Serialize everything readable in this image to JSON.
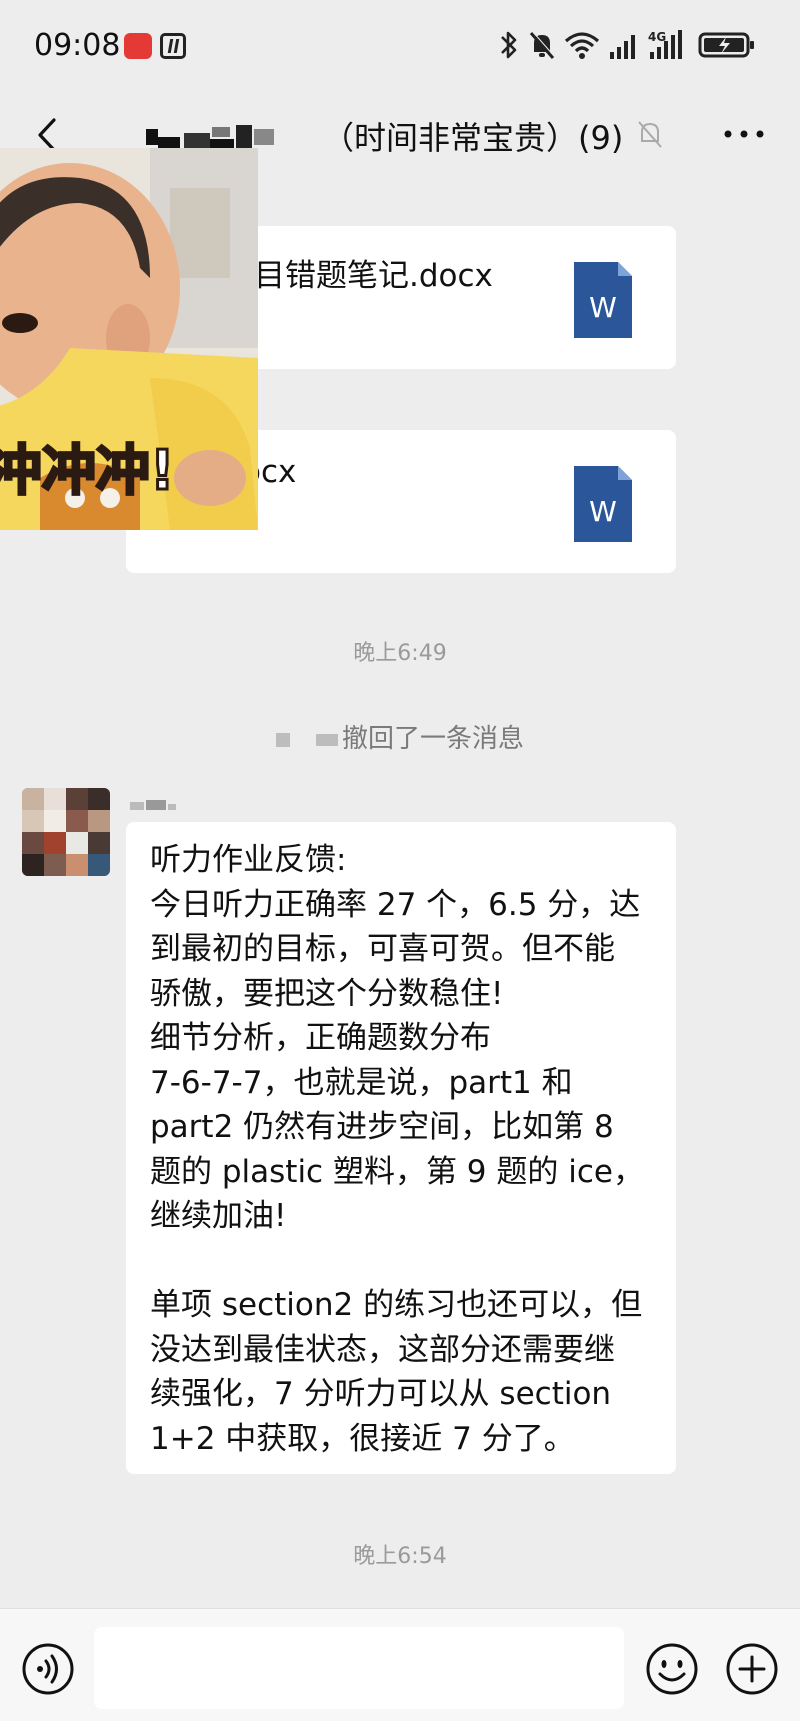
{
  "status_bar": {
    "time": "09:08",
    "icons": [
      "bluetooth-icon",
      "mute-bell-icon",
      "wifi-icon",
      "signal-icon",
      "4g-signal-icon",
      "battery-charging-icon"
    ],
    "network_label": "4G"
  },
  "header": {
    "title": "（时间非常宝贵）(9)",
    "back_icon": "back-arrow-icon",
    "mute_icon": "mute-bell-icon",
    "more_icon": "more-dots-icon"
  },
  "messages": {
    "file1": {
      "name": "目错题笔记.docx",
      "icon": "word-doc-icon",
      "icon_letter": "W"
    },
    "file2": {
      "name": "ocx",
      "icon": "word-doc-icon",
      "icon_letter": "W"
    },
    "sticker_text": "冲冲冲!",
    "time1": "晚上6:49",
    "recall_text": "撤回了一条消息",
    "time2": "晚上6:54"
  },
  "feedback_message": {
    "lines": [
      "听力作业反馈:",
      "今日听力正确率 27 个，6.5 分，达",
      "到最初的目标，可喜可贺。但不能",
      "骄傲，要把这个分数稳住!",
      "细节分析，正确题数分布",
      "7-6-7-7，也就是说，part1 和",
      "part2 仍然有进步空间，比如第 8",
      "题的 plastic 塑料，第 9 题的 ice，",
      "继续加油!",
      "",
      "单项 section2 的练习也还可以，但",
      "没达到最佳状态，这部分还需要继",
      "续强化，7 分听力可以从 section",
      "1+2 中获取，很接近 7 分了。"
    ]
  },
  "input_bar": {
    "voice_icon": "voice-icon",
    "emoji_icon": "emoji-icon",
    "plus_icon": "plus-icon",
    "input_value": ""
  },
  "colors": {
    "background": "#ededed",
    "bubble": "#ffffff",
    "word_blue": "#2b579a",
    "timestamp": "#9a9a9a"
  }
}
